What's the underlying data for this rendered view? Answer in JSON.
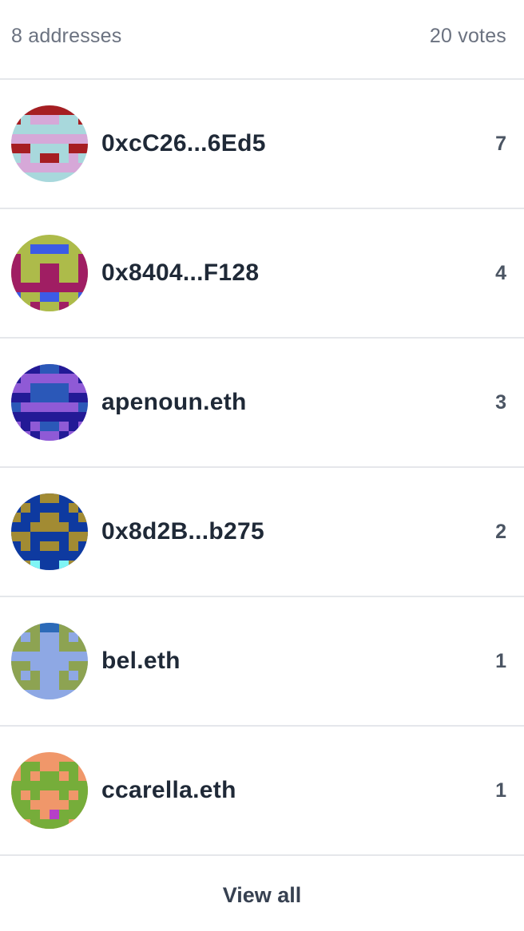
{
  "summary": {
    "addresses": "8 addresses",
    "votes": "20 votes"
  },
  "voters": [
    {
      "name": "0xcC26...6Ed5",
      "votes": "7",
      "avatar": {
        "bg": "#a8d8dc",
        "c1": "#a61e22",
        "c2": "#d6a8d8",
        "grid": [
          "AAAAAAA",
          "A011100A",
          "00000000",
          "B111111B",
          "AA0000AA",
          "0B0AA0B0",
          "B111111B",
          "00000000"
        ]
      }
    },
    {
      "name": "0x8404...F128",
      "votes": "4",
      "avatar": {
        "bg": "#adbb4a",
        "c1": "#a01e63",
        "c2": "#3c5be6",
        "grid": [
          "00000000",
          "00B11B00",
          "A000000A",
          "A00AA00A",
          "A00AA00A",
          "AAAAAAAA",
          "B00BB00B",
          "00A00A00"
        ]
      }
    },
    {
      "name": "apenoun.eth",
      "votes": "3",
      "avatar": {
        "bg": "#8f5ad6",
        "c1": "#231a96",
        "c2": "#2b58b8",
        "grid": [
          "AAABBAAA",
          "A000000A",
          "00BBBB00",
          "AABBBBAA",
          "B000000B",
          "AAAAAAAA",
          "0A0BB0A0",
          "00A00A00"
        ]
      }
    },
    {
      "name": "0x8d2B...b275",
      "votes": "2",
      "avatar": {
        "bg": "#0e3aa0",
        "c1": "#a28b33",
        "c2": "#7ff5f5",
        "grid": [
          "A00AA00A",
          "0A0000A0",
          "A00AA00A",
          "00AAAA00",
          "AA0000AA",
          "0A0AA0A0",
          "00000000",
          "BAB00BAB"
        ]
      }
    },
    {
      "name": "bel.eth",
      "votes": "1",
      "avatar": {
        "bg": "#8ea8e4",
        "c1": "#8da352",
        "c2": "#2c6ab8",
        "grid": [
          "0AABBAA0",
          "A0A00A0A",
          "AAA00AAA",
          "00000000",
          "AA0000AA",
          "A0A00A0A",
          "AAA00AAA",
          "00000000"
        ]
      }
    },
    {
      "name": "ccarella.eth",
      "votes": "1",
      "avatar": {
        "bg": "#f0976a",
        "c1": "#76ad3a",
        "c2": "#b640c8",
        "grid": [
          "00000000",
          "0AA00AA0",
          "0A0AA0A0",
          "AAAAAAAA",
          "A0A00A0A",
          "AA0000AA",
          "AAA0BAAA",
          "00AAAA00"
        ]
      }
    }
  ],
  "footer": {
    "view_all_label": "View all"
  }
}
